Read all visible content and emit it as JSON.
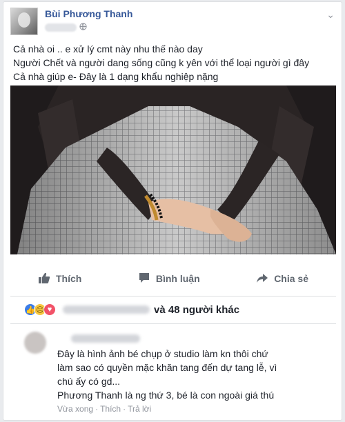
{
  "post": {
    "author": "Bùi Phương Thanh",
    "lines": [
      "Cả nhà oi .. e xử lý cmt này nhu thế nào day",
      "Người Chết và người dang sống cũng k yên với thể loại người gì đây",
      "Cả nhà giúp e- Đây là 1 dạng khẩu nghiệp nặng"
    ]
  },
  "actions": {
    "like": "Thích",
    "comment": "Bình luận",
    "share": "Chia sẻ"
  },
  "reactions": {
    "others": "và 48 người khác"
  },
  "comment": {
    "text": "Đây là hình ảnh bé chụp ở studio làm kn thôi chứ làm sao có quyền mặc khăn tang đến dự tang lễ, vì chú ấy có gd... Phương Thanh là ng thứ 3, bé là con ngoài giá thú",
    "lines": [
      "Đây là hình ảnh bé chụp ở studio làm kn thôi chứ",
      "làm sao có quyền mặc khăn tang đến dự tang lễ, vì",
      "chú ấy có gd...",
      "Phương Thanh là ng thứ 3, bé là con ngoài giá thú"
    ],
    "meta": {
      "time": "Vừa xong",
      "like": "Thích",
      "reply": "Trả lời",
      "dot": "·"
    }
  }
}
